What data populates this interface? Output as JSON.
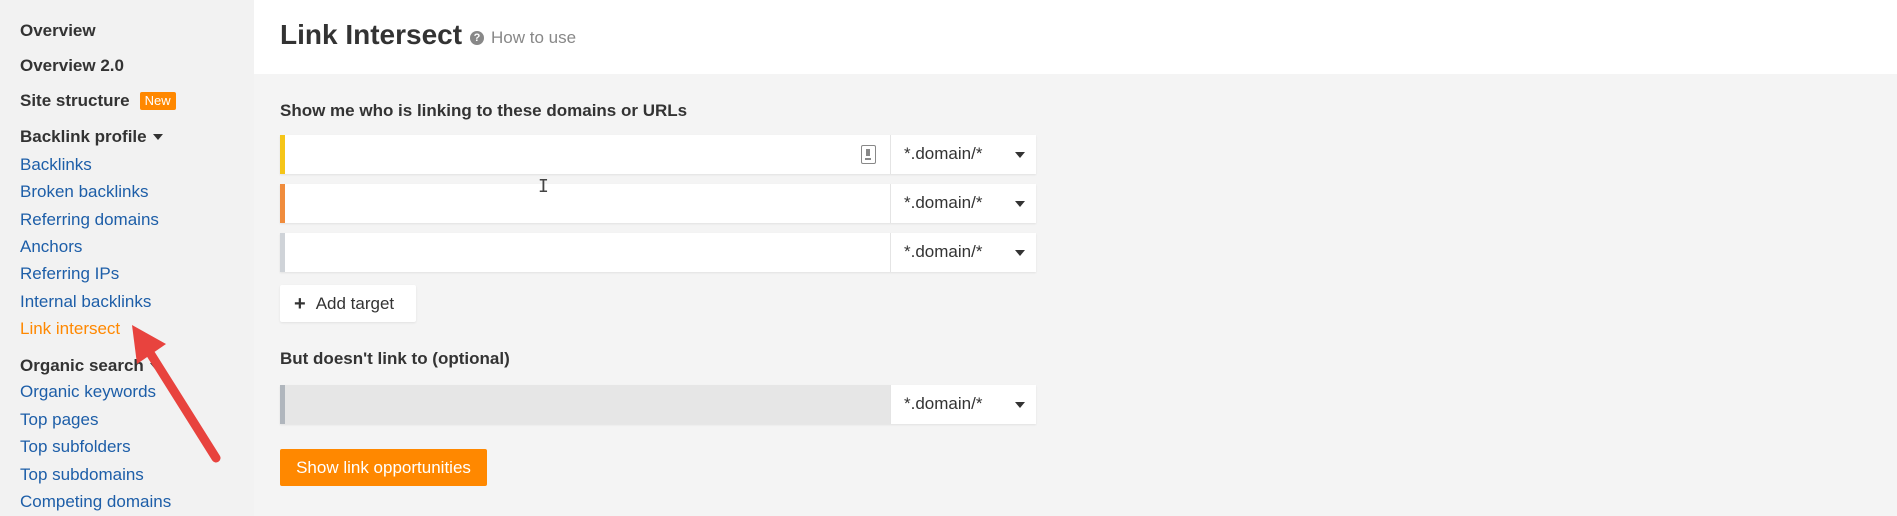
{
  "sidebar": {
    "overview": "Overview",
    "overview2": "Overview 2.0",
    "site_structure": "Site structure",
    "new_badge": "New",
    "backlink_profile": "Backlink profile",
    "backlink_links": [
      "Backlinks",
      "Broken backlinks",
      "Referring domains",
      "Anchors",
      "Referring IPs",
      "Internal backlinks",
      "Link intersect"
    ],
    "organic_search": "Organic search",
    "organic_links": [
      "Organic keywords",
      "Top pages",
      "Top subfolders",
      "Top subdomains",
      "Competing domains"
    ],
    "active_item": "Link intersect"
  },
  "header": {
    "title": "Link Intersect",
    "help_text": "How to use",
    "help_icon": "question-circle-icon"
  },
  "main": {
    "targets_label": "Show me who is linking to these domains or URLs",
    "targets": [
      {
        "value": "",
        "mode": "*.domain/*",
        "accent": "#f5c518"
      },
      {
        "value": "",
        "mode": "*.domain/*",
        "accent": "#f08c3c"
      },
      {
        "value": "",
        "mode": "*.domain/*",
        "accent": "#cfd3d8"
      }
    ],
    "add_target": "Add target",
    "exclude_label": "But doesn't link to (optional)",
    "exclude": {
      "value": "",
      "mode": "*.domain/*",
      "accent": "#b0b6bd"
    },
    "submit": "Show link opportunities"
  },
  "colors": {
    "accent": "#ff8800",
    "link": "#1d5ea8",
    "annotation_arrow": "#e8433e"
  }
}
